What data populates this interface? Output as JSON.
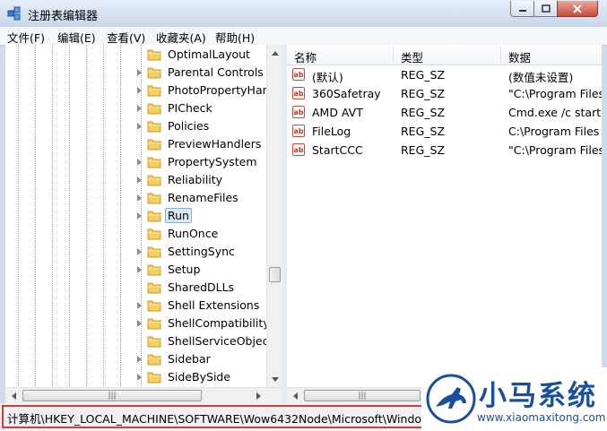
{
  "window": {
    "title": "注册表编辑器"
  },
  "menu": [
    "文件(F)",
    "编辑(E)",
    "查看(V)",
    "收藏夹(A)",
    "帮助(H)"
  ],
  "tree": {
    "items": [
      {
        "label": "OptimalLayout",
        "expandable": false
      },
      {
        "label": "Parental Controls",
        "expandable": true
      },
      {
        "label": "PhotoPropertyHandler",
        "expandable": true
      },
      {
        "label": "PICheck",
        "expandable": true
      },
      {
        "label": "Policies",
        "expandable": true
      },
      {
        "label": "PreviewHandlers",
        "expandable": false
      },
      {
        "label": "PropertySystem",
        "expandable": true
      },
      {
        "label": "Reliability",
        "expandable": true
      },
      {
        "label": "RenameFiles",
        "expandable": true
      },
      {
        "label": "Run",
        "expandable": true,
        "selected": true
      },
      {
        "label": "RunOnce",
        "expandable": false
      },
      {
        "label": "SettingSync",
        "expandable": true
      },
      {
        "label": "Setup",
        "expandable": true
      },
      {
        "label": "SharedDLLs",
        "expandable": false
      },
      {
        "label": "Shell Extensions",
        "expandable": true
      },
      {
        "label": "ShellCompatibility",
        "expandable": true
      },
      {
        "label": "ShellServiceObjectDelayLoad",
        "expandable": false
      },
      {
        "label": "Sidebar",
        "expandable": true
      },
      {
        "label": "SideBySide",
        "expandable": true
      }
    ]
  },
  "list": {
    "columns": [
      "名称",
      "类型",
      "数据"
    ],
    "rows": [
      {
        "name": "(默认)",
        "type": "REG_SZ",
        "data": "(数值未设置)"
      },
      {
        "name": "360Safetray",
        "type": "REG_SZ",
        "data": "\"C:\\Program Files"
      },
      {
        "name": "AMD AVT",
        "type": "REG_SZ",
        "data": "Cmd.exe /c start"
      },
      {
        "name": "FileLog",
        "type": "REG_SZ",
        "data": "C:\\Program Files"
      },
      {
        "name": "StartCCC",
        "type": "REG_SZ",
        "data": "\"C:\\Program Files"
      }
    ]
  },
  "status": {
    "path": "计算机\\HKEY_LOCAL_MACHINE\\SOFTWARE\\Wow6432Node\\Microsoft\\Windows"
  },
  "watermark": {
    "brand": "小马系统",
    "url": "www.xiaomaxitong.com"
  },
  "colors": {
    "accent": "#1a4f9e",
    "highlight": "#d63a3a",
    "selection": "#dbe8f8"
  }
}
